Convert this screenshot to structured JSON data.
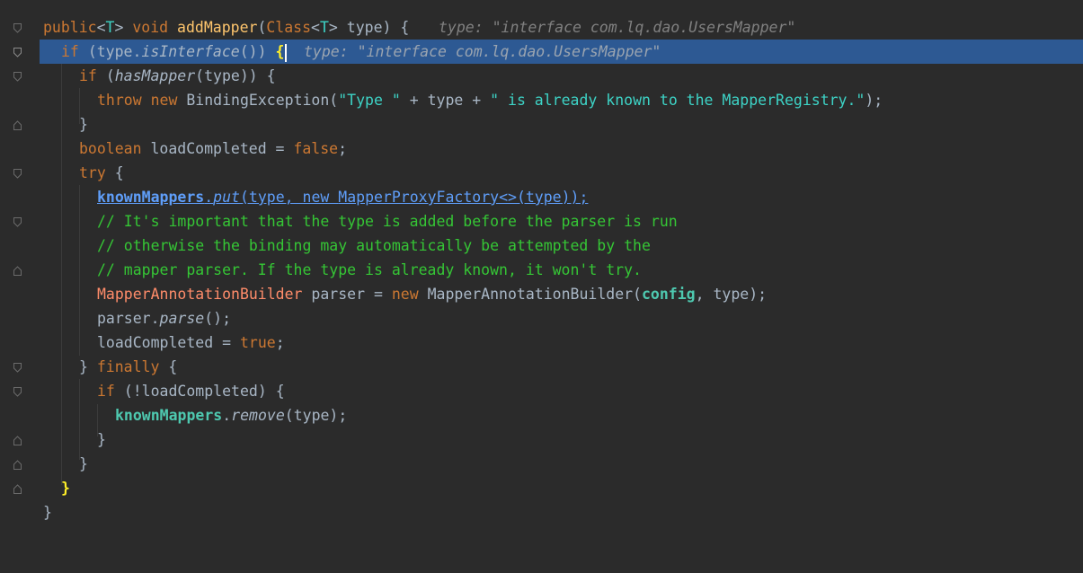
{
  "editor": {
    "lines": [
      {
        "text": "public <T> void addMapper(Class<T> type) {",
        "hint": "type: \"interface com.lq.dao.UsersMapper\""
      },
      {
        "text": "if (type.isInterface()) {",
        "hint": "type: \"interface com.lq.dao.UsersMapper\""
      },
      {
        "text": "if (hasMapper(type)) {"
      },
      {
        "text": "throw new BindingException(\"Type \" + type + \" is already known to the MapperRegistry.\");"
      },
      {
        "text": "}"
      },
      {
        "text": "boolean loadCompleted = false;"
      },
      {
        "text": "try {"
      },
      {
        "text": "knownMappers.put(type, new MapperProxyFactory<>(type));"
      },
      {
        "text": "// It's important that the type is added before the parser is run"
      },
      {
        "text": "// otherwise the binding may automatically be attempted by the"
      },
      {
        "text": "// mapper parser. If the type is already known, it won't try."
      },
      {
        "text": "MapperAnnotationBuilder parser = new MapperAnnotationBuilder(config, type);"
      },
      {
        "text": "parser.parse();"
      },
      {
        "text": "loadCompleted = true;"
      },
      {
        "text": "} finally {"
      },
      {
        "text": "if (!loadCompleted) {"
      },
      {
        "text": "knownMappers.remove(type);"
      },
      {
        "text": "}"
      },
      {
        "text": "}"
      },
      {
        "text": "}"
      },
      {
        "text": "}"
      }
    ]
  },
  "tokens": {
    "l0": [
      "public",
      "<",
      "T",
      "> ",
      "void ",
      "addMapper",
      "(",
      "Class",
      "<",
      "T",
      "> type) {"
    ],
    "l1": [
      "if ",
      "(type.",
      "isInterface",
      "()) ",
      "{"
    ],
    "l2": [
      "if ",
      "(",
      "hasMapper",
      "(type)) {"
    ],
    "l3": [
      "throw ",
      "new ",
      "BindingException(",
      "\"Type \"",
      " + type + ",
      "\" is already known to the MapperRegistry.\"",
      ");"
    ],
    "l5": [
      "boolean ",
      "loadCompleted = ",
      "false",
      ";"
    ],
    "l6": [
      "try ",
      "{"
    ],
    "l7": [
      "knownMappers",
      ".",
      "put",
      "(type, ",
      "new ",
      "MapperProxyFactory<>(type));"
    ],
    "l11": [
      "MapperAnnotationBuilder",
      " parser = ",
      "new ",
      "MapperAnnotationBuilder(",
      "config",
      ", type);"
    ],
    "l12": [
      "parser.",
      "parse",
      "();"
    ],
    "l13": [
      "loadCompleted = ",
      "true",
      ";"
    ],
    "l14": [
      "} ",
      "finally ",
      "{"
    ],
    "l15": [
      "if ",
      "(!loadCompleted) {"
    ],
    "l16": [
      "knownMappers",
      ".",
      "remove",
      "(type);"
    ]
  },
  "colors": {
    "background": "#2b2b2b",
    "keyword": "#cc7832",
    "method": "#ffc66d",
    "string": "#3dd3c6",
    "comment": "#35c635",
    "field": "#4ec9b0",
    "class": "#ff8c6a",
    "selection": "#2d5993",
    "inline_hint": "#808080"
  }
}
